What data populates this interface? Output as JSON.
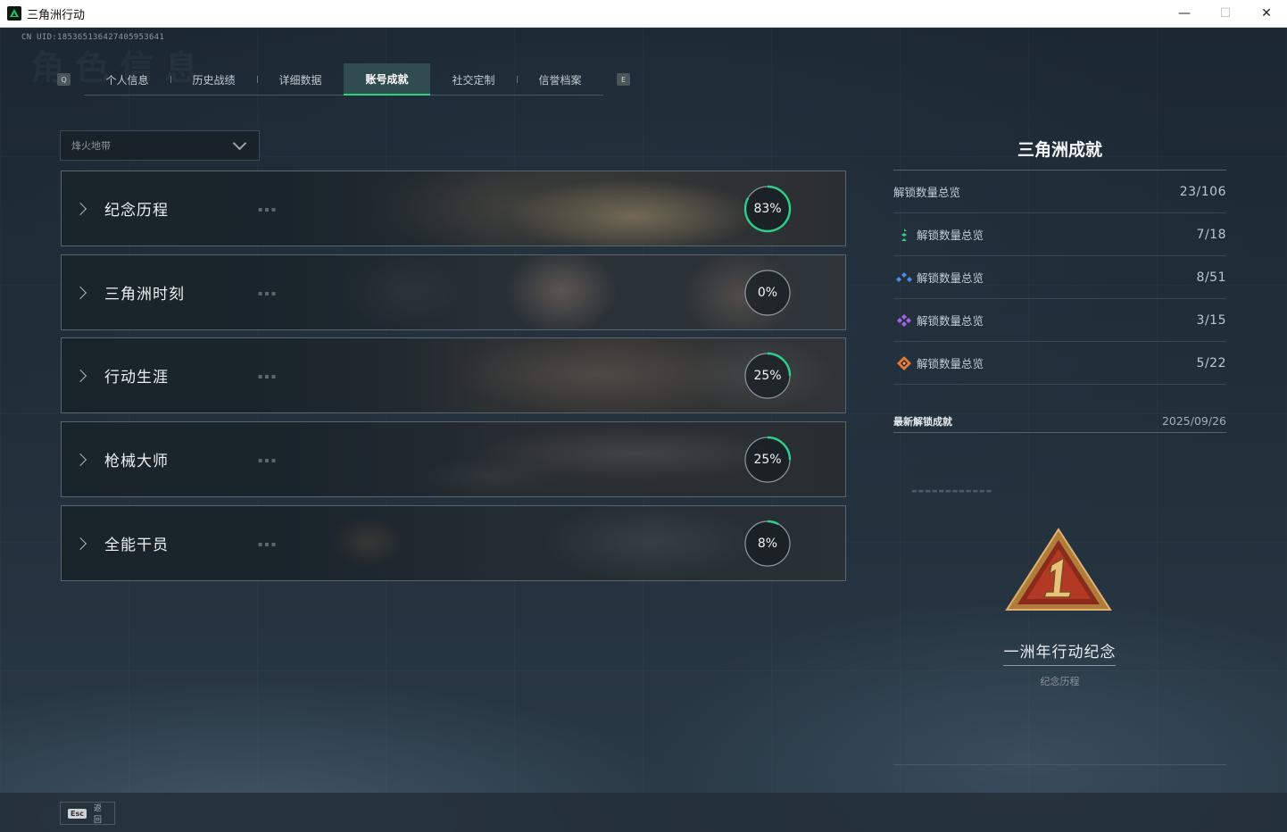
{
  "window": {
    "title": "三角洲行动",
    "minimize": "—",
    "maximize": "☐",
    "close": "✕"
  },
  "header": {
    "uid": "CN UID:18536513642740595364​1",
    "bg_title": "角色信息"
  },
  "tabs": {
    "left_key": "Q",
    "right_key": "E",
    "items": [
      {
        "label": "个人信息",
        "active": false
      },
      {
        "label": "历史战绩",
        "active": false
      },
      {
        "label": "详细数据",
        "active": false
      },
      {
        "label": "账号成就",
        "active": true
      },
      {
        "label": "社交定制",
        "active": false
      },
      {
        "label": "信誉档案",
        "active": false
      }
    ]
  },
  "filter": {
    "selected": "烽火地带"
  },
  "categories": [
    {
      "label": "纪念历程",
      "progress_text": "83%",
      "progress": 0.83
    },
    {
      "label": "三角洲时刻",
      "progress_text": "0%",
      "progress": 0.0
    },
    {
      "label": "行动生涯",
      "progress_text": "25%",
      "progress": 0.25
    },
    {
      "label": "枪械大师",
      "progress_text": "25%",
      "progress": 0.25
    },
    {
      "label": "全能干员",
      "progress_text": "8%",
      "progress": 0.08
    }
  ],
  "panel": {
    "title": "三角洲成就",
    "total": {
      "label": "解锁数量总览",
      "value": "23/106"
    },
    "tiers": [
      {
        "label": "解锁数量总览",
        "value": "7/18",
        "icon": "green-rank-icon",
        "color": "#2fd08a"
      },
      {
        "label": "解锁数量总览",
        "value": "8/51",
        "icon": "blue-rank-icon",
        "color": "#4a8fe0"
      },
      {
        "label": "解锁数量总览",
        "value": "3/15",
        "icon": "purple-rank-icon",
        "color": "#a463e6"
      },
      {
        "label": "解锁数量总览",
        "value": "5/22",
        "icon": "orange-rank-icon",
        "color": "#e07b3a"
      }
    ],
    "latest": {
      "label": "最新解锁成就",
      "date": "2025/09/26"
    },
    "showcase": {
      "name": "一洲年行动纪念",
      "category": "纪念历程"
    }
  },
  "footer": {
    "esc_key": "Esc",
    "esc_label": "返回"
  }
}
